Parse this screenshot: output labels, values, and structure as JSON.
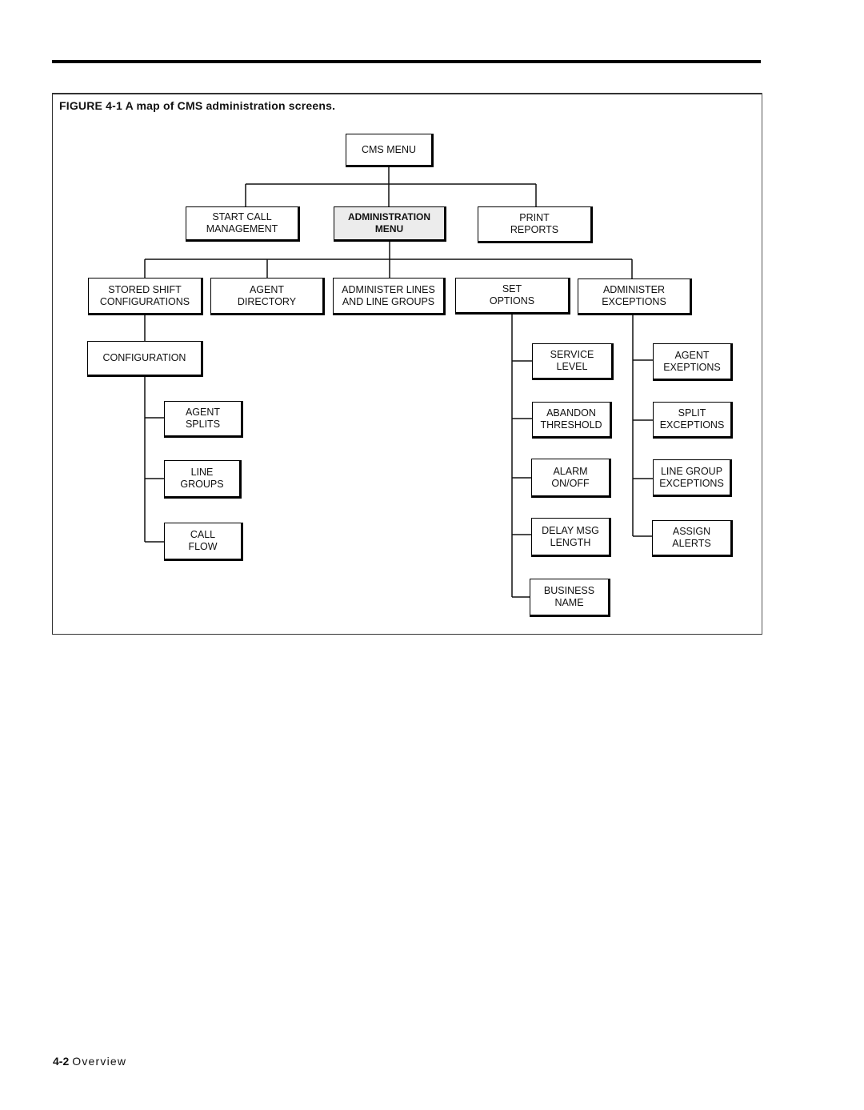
{
  "figure": {
    "caption": "FIGURE 4-1 A map of CMS administration screens."
  },
  "nodes": {
    "cms_menu": "CMS MENU",
    "start_call_management": "START CALL\nMANAGEMENT",
    "administration_menu": "ADMINISTRATION\nMENU",
    "print_reports": "PRINT\nREPORTS",
    "stored_shift_configurations": "STORED SHIFT\nCONFIGURATIONS",
    "agent_directory": "AGENT\nDIRECTORY",
    "administer_lines": "ADMINISTER LINES\nAND LINE GROUPS",
    "set_options": "SET\nOPTIONS",
    "administer_exceptions": "ADMINISTER\nEXCEPTIONS",
    "configuration": "CONFIGURATION",
    "agent_splits": "AGENT\nSPLITS",
    "line_groups": "LINE\nGROUPS",
    "call_flow": "CALL\nFLOW",
    "service_level": "SERVICE\nLEVEL",
    "abandon_threshold": "ABANDON\nTHRESHOLD",
    "alarm_on_off": "ALARM\nON/OFF",
    "delay_msg_length": "DELAY MSG\nLENGTH",
    "business_name": "BUSINESS\nNAME",
    "agent_exceptions": "AGENT\nEXEPTIONS",
    "split_exceptions": "SPLIT\nEXCEPTIONS",
    "line_group_exceptions": "LINE GROUP\nEXCEPTIONS",
    "assign_alerts": "ASSIGN\nALERTS"
  },
  "footer": {
    "page_number": "4-2",
    "section": "Overview"
  }
}
